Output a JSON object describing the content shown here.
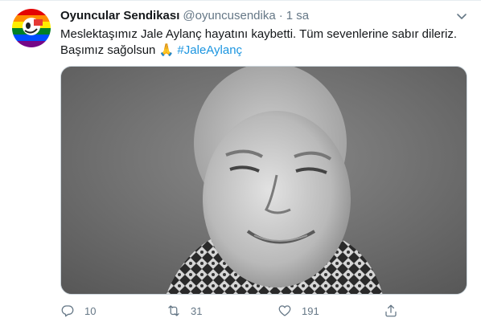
{
  "tweet": {
    "author": {
      "display_name": "Oyuncular Sendikası",
      "handle": "@oyuncusendika",
      "separator": "·",
      "time": "1 sa"
    },
    "text_line1": "Meslektaşımız Jale Aylanç hayatını kaybetti. Tüm sevenlerine sabır dileriz.",
    "text_line2": "Başımız sağolsun",
    "emoji": "🙏",
    "hashtag": "#JaleAylanç",
    "media": {
      "description_icon": "photo",
      "style": "grayscale portrait"
    },
    "actions": {
      "reply_count": "10",
      "retweet_count": "31",
      "like_count": "191"
    },
    "colors": {
      "link": "#1b95e0",
      "secondary_text": "#657786",
      "primary_text": "#14171a"
    }
  }
}
